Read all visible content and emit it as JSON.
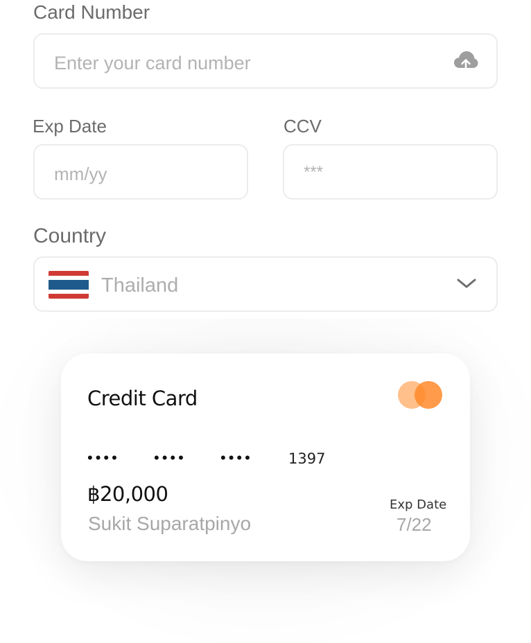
{
  "form": {
    "card_number": {
      "label": "Card Number",
      "placeholder": "Enter your card number",
      "value": ""
    },
    "exp_date": {
      "label": "Exp Date",
      "placeholder": "mm/yy",
      "value": ""
    },
    "ccv": {
      "label": "CCV",
      "placeholder": "***",
      "value": ""
    },
    "country": {
      "label": "Country",
      "selected": "Thailand",
      "flag_icon": "thailand-flag-icon"
    }
  },
  "icons": {
    "upload": "cloud-upload-icon",
    "dropdown": "chevron-down-icon",
    "card_brand": "mastercard-logo-icon"
  },
  "card": {
    "title": "Credit Card",
    "masked_groups": [
      "••••",
      "••••",
      "••••"
    ],
    "last4": "1397",
    "balance": "฿20,000",
    "holder": "Sukit Suparatpinyo",
    "exp_label": "Exp Date",
    "exp_value": "7/22"
  },
  "colors": {
    "label": "#6b6b6b",
    "border": "#ececec",
    "placeholder": "#b3b3b3",
    "brand_circle_light": "#ffc08c",
    "brand_circle_dark": "#ff8a2a",
    "flag_red": "#d03a34",
    "flag_white": "#ffffff",
    "flag_blue": "#1f5a8c"
  }
}
